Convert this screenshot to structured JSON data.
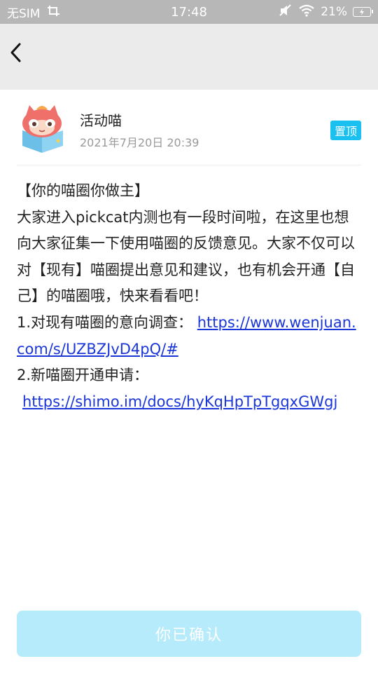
{
  "status_bar": {
    "carrier": "无SIM",
    "time": "17:48",
    "battery": "21%"
  },
  "post": {
    "author": "活动喵",
    "date": "2021年7月20日 20:39",
    "badge": "置顶",
    "lines": {
      "title": "【你的喵圈你做主】",
      "body": "大家进入pickcat内测也有一段时间啦，在这里也想向大家征集一下使用喵圈的反馈意见。大家不仅可以对【现有】喵圈提出意见和建议，也有机会开通【自己】的喵圈哦，快来看看吧！",
      "item1_label": "1.对现有喵圈的意向调查：",
      "item1_link": "https://www.wenjuan.com/s/UZBZJvD4pQ/#",
      "item2_label": "2.新喵圈开通申请：",
      "item2_link": "https://shimo.im/docs/hyKqHpTpTgqxGWgj"
    }
  },
  "confirm_button": "你已确认",
  "colors": {
    "status_bar": "#b7b7b7",
    "nav_bar": "#ebebeb",
    "accent": "#19c0f0",
    "link": "#1a35d8",
    "button_disabled": "#b5ebfb"
  },
  "icons": [
    "back-chevron-icon",
    "screenshot-icon",
    "mute-icon",
    "wifi-icon",
    "battery-icon",
    "cat-mascot-avatar"
  ]
}
